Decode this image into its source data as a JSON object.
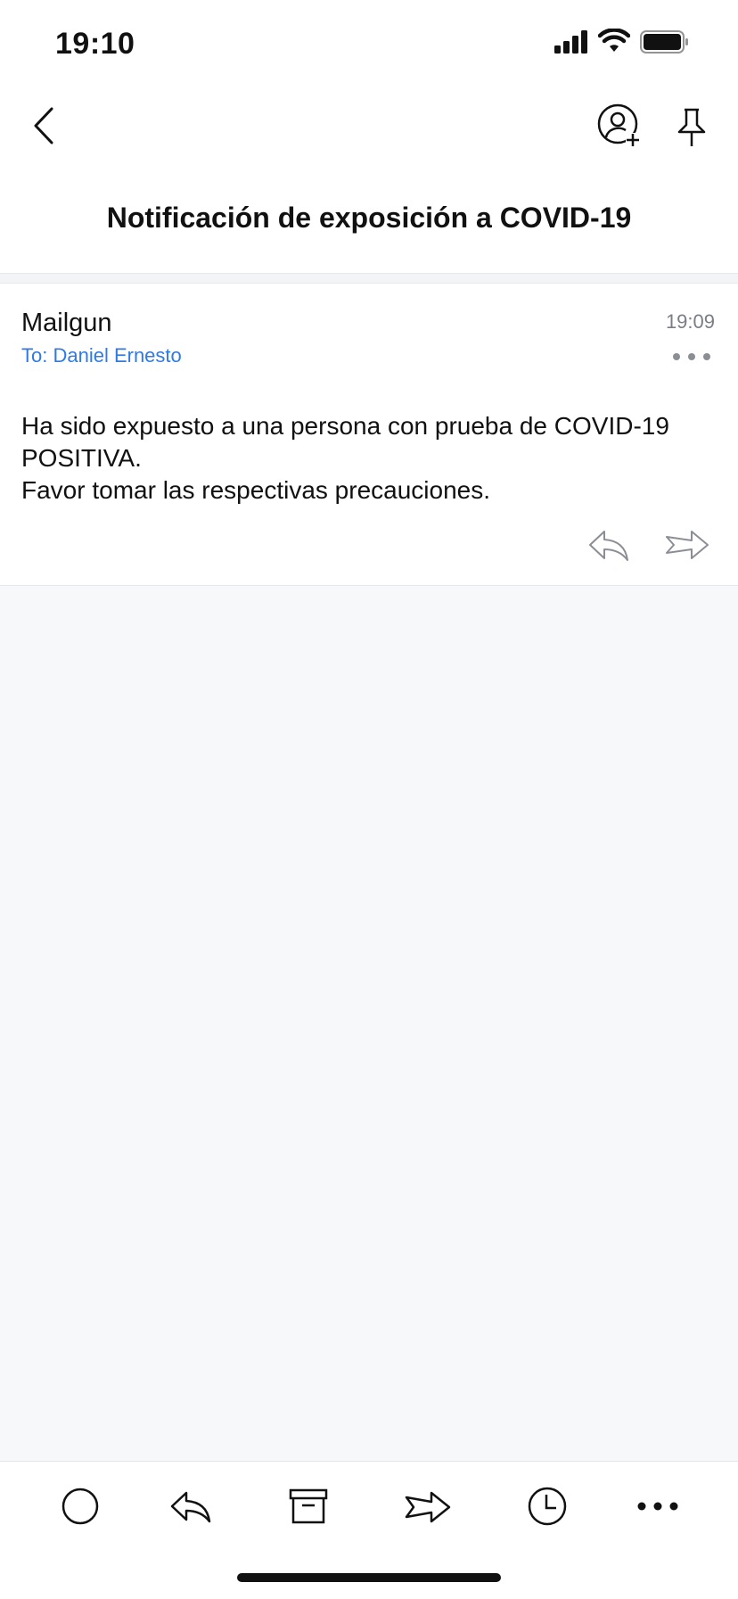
{
  "status_bar": {
    "time": "19:10"
  },
  "header": {
    "subject": "Notificación de exposición a COVID-19"
  },
  "message": {
    "sender": "Mailgun",
    "recipient": "To: Daniel Ernesto",
    "time": "19:09",
    "body_line1": "Ha sido expuesto a una persona con prueba de COVID-19 POSITIVA.",
    "body_line2": "Favor tomar las respectivas precauciones."
  },
  "icons": {
    "nav": [
      "chevron-left-icon",
      "add-contact-icon",
      "pin-icon"
    ],
    "message": [
      "more-icon",
      "reply-icon",
      "forward-icon"
    ],
    "toolbar": [
      "circle-icon",
      "reply-icon",
      "archive-icon",
      "forward-icon",
      "clock-icon",
      "more-icon"
    ]
  },
  "colors": {
    "accent": "#2f7ae5",
    "icon_gray": "#8b8e95",
    "background": "#f7f8fa"
  }
}
